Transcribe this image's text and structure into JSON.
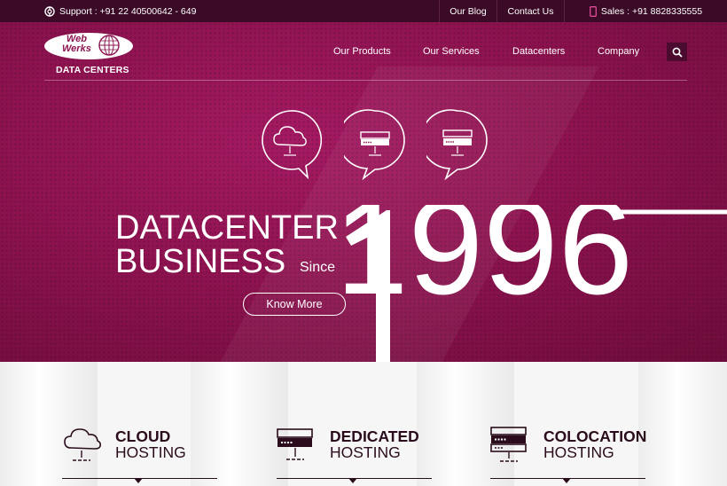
{
  "topbar": {
    "support": "Support : +91 22 40500642 - 649",
    "blog": "Our Blog",
    "contact": "Contact Us",
    "sales": "Sales : +91 8828335555"
  },
  "logo": {
    "line1": "Web",
    "line2": "Werks",
    "sub": "DATA CENTERS"
  },
  "nav": {
    "items": [
      "Our Products",
      "Our Services",
      "Datacenters",
      "Company"
    ]
  },
  "hero": {
    "line1": "DATACENTER",
    "line2": "BUSINESS",
    "since": "Since",
    "year": "1996",
    "cta": "Know More"
  },
  "services": [
    {
      "line1": "CLOUD",
      "line2": "HOSTING",
      "icon": "cloud-icon"
    },
    {
      "line1": "DEDICATED",
      "line2": "HOSTING",
      "icon": "server-icon"
    },
    {
      "line1": "COLOCATION",
      "line2": "HOSTING",
      "icon": "server-rack-icon"
    }
  ],
  "colors": {
    "topbar": "#3a0a26",
    "hero": "#8e1350",
    "text_dark": "#2a0c1c"
  }
}
